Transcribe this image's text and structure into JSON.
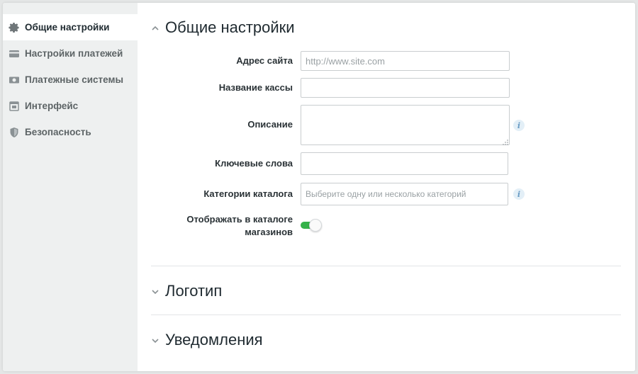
{
  "sidebar": {
    "items": [
      {
        "label": "Общие настройки",
        "icon": "gear-icon",
        "active": true
      },
      {
        "label": "Настройки платежей",
        "icon": "credit-card-icon",
        "active": false
      },
      {
        "label": "Платежные системы",
        "icon": "money-icon",
        "active": false
      },
      {
        "label": "Интерфейс",
        "icon": "window-icon",
        "active": false
      },
      {
        "label": "Безопасность",
        "icon": "shield-icon",
        "active": false
      }
    ]
  },
  "sections": {
    "general": {
      "title": "Общие настройки",
      "expanded": true
    },
    "logo": {
      "title": "Логотип",
      "expanded": false
    },
    "notifications": {
      "title": "Уведомления",
      "expanded": false
    }
  },
  "form": {
    "site_address": {
      "label": "Адрес сайта",
      "value": "",
      "placeholder": "http://www.site.com"
    },
    "cashbox_name": {
      "label": "Название кассы",
      "value": "",
      "placeholder": ""
    },
    "description": {
      "label": "Описание",
      "value": "",
      "placeholder": ""
    },
    "keywords": {
      "label": "Ключевые слова",
      "value": "",
      "placeholder": ""
    },
    "catalog_categories": {
      "label": "Категории каталога",
      "value": "",
      "placeholder": "Выберите одну или несколько категорий"
    },
    "show_in_catalog": {
      "label_line1": "Отображать в каталоге",
      "label_line2": "магазинов",
      "enabled": true
    }
  },
  "info_symbol": "i",
  "colors": {
    "toggle_on": "#35b24a",
    "info_icon": "#6a9cc4",
    "sidebar_bg": "#eef0f0",
    "page_bg": "#e4e6e6"
  }
}
